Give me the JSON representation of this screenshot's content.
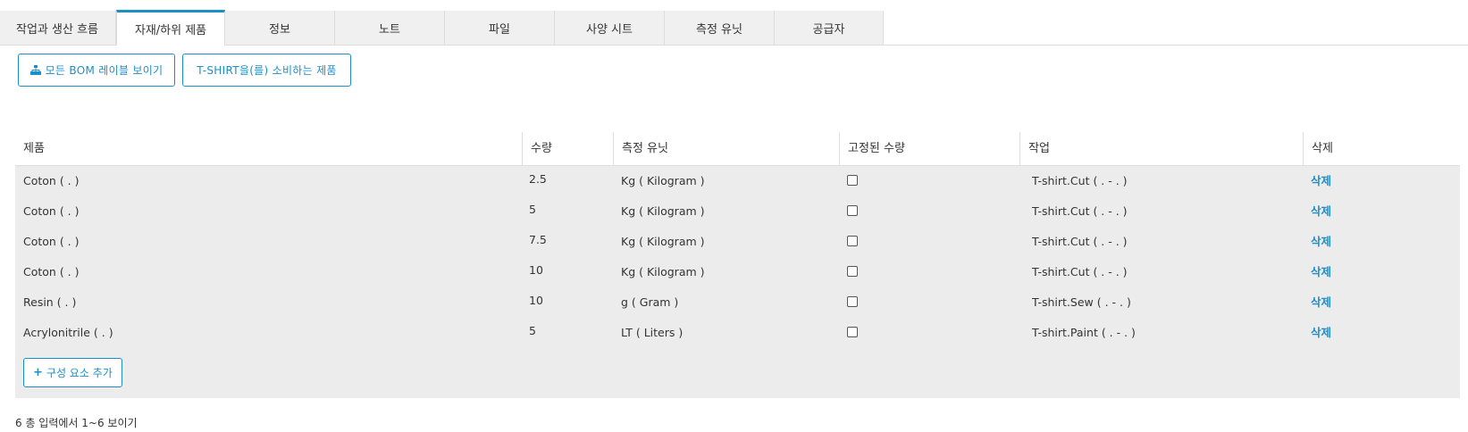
{
  "tabs": [
    {
      "label": "작업과 생산 흐름",
      "active": false
    },
    {
      "label": "자재/하위 제품",
      "active": true
    },
    {
      "label": "정보",
      "active": false
    },
    {
      "label": "노트",
      "active": false
    },
    {
      "label": "파일",
      "active": false
    },
    {
      "label": "사양 시트",
      "active": false
    },
    {
      "label": "측정 유닛",
      "active": false
    },
    {
      "label": "공급자",
      "active": false
    }
  ],
  "toolbar": {
    "bom_levels_label": "모든 BOM 레이블 보이기",
    "consumers_label": "T-SHIRT을(를) 소비하는 제품",
    "bom_icon": "sitemap-icon"
  },
  "table": {
    "columns": {
      "product": "제품",
      "quantity": "수량",
      "uom": "측정 유닛",
      "fixed_qty": "고정된 수량",
      "operation": "작업",
      "delete": "삭제"
    },
    "rows": [
      {
        "product": "Coton ( . )",
        "quantity": "2.5",
        "uom": "Kg ( Kilogram )",
        "fixed": false,
        "operation": "T-shirt.Cut ( . - . )",
        "delete": "삭제"
      },
      {
        "product": "Coton ( . )",
        "quantity": "5",
        "uom": "Kg ( Kilogram )",
        "fixed": false,
        "operation": "T-shirt.Cut ( . - . )",
        "delete": "삭제"
      },
      {
        "product": "Coton ( . )",
        "quantity": "7.5",
        "uom": "Kg ( Kilogram )",
        "fixed": false,
        "operation": "T-shirt.Cut ( . - . )",
        "delete": "삭제"
      },
      {
        "product": "Coton ( . )",
        "quantity": "10",
        "uom": "Kg ( Kilogram )",
        "fixed": false,
        "operation": "T-shirt.Cut ( . - . )",
        "delete": "삭제"
      },
      {
        "product": "Resin ( . )",
        "quantity": "10",
        "uom": "g ( Gram )",
        "fixed": false,
        "operation": "T-shirt.Sew ( . - . )",
        "delete": "삭제"
      },
      {
        "product": "Acrylonitrile ( . )",
        "quantity": "5",
        "uom": "LT ( Liters )",
        "fixed": false,
        "operation": "T-shirt.Paint ( . - . )",
        "delete": "삭제"
      }
    ],
    "add_component_label": "구성 요소 추가"
  },
  "summary": "6 총 입력에서 1~6 보이기",
  "colors": {
    "accent": "#1b8fc9",
    "row_background": "#ececec",
    "tab_background": "#f0f0f0"
  }
}
